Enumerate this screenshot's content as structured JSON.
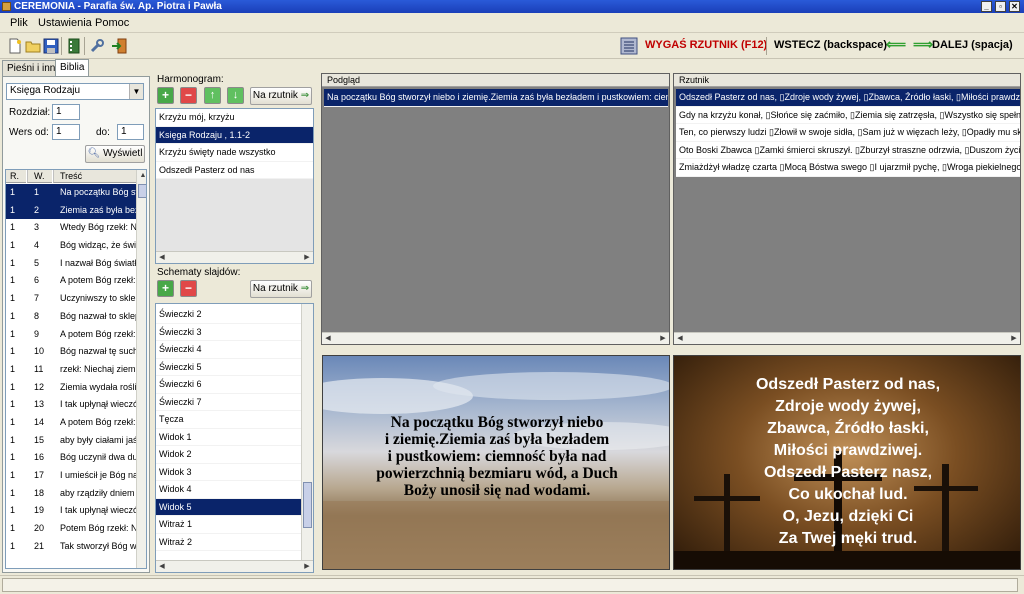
{
  "window": {
    "title": "CEREMONIA - Parafia św. Ap. Piotra i Pawła"
  },
  "menu": [
    "Plik",
    "Ustawienia",
    "Pomoc"
  ],
  "toolbar": {
    "blank_label": "WYGAŚ RZUTNIK (F12)",
    "back_label": "WSTECZ (backspace)",
    "next_label": "DALEJ (spacja)",
    "colors": {
      "blank": "#c00000"
    }
  },
  "tabs": [
    "Pieśni i inne",
    "Biblia"
  ],
  "bible": {
    "book": "Księga Rodzaju",
    "chapter_label": "Rozdział:",
    "chapter": "1",
    "verse_from_label": "Wers od:",
    "verse_from": "1",
    "verse_to_label": "do:",
    "verse_to": "1",
    "show_button": "Wyświetl",
    "columns": [
      "R.",
      "W.",
      "Treść"
    ],
    "rows": [
      [
        "1",
        "1",
        "Na początku Bóg stw"
      ],
      [
        "1",
        "2",
        "Ziemia zaś była bez"
      ],
      [
        "1",
        "3",
        "Wtedy Bóg rzekł: Ni"
      ],
      [
        "1",
        "4",
        "Bóg widząc, że świa"
      ],
      [
        "1",
        "5",
        "I nazwał Bóg światło"
      ],
      [
        "1",
        "6",
        "A potem Bóg rzekł:"
      ],
      [
        "1",
        "7",
        "Uczyniwszy to sklep"
      ],
      [
        "1",
        "8",
        "Bóg nazwał to sklep"
      ],
      [
        "1",
        "9",
        "A potem Bóg rzekł:"
      ],
      [
        "1",
        "10",
        "Bóg nazwał tę such"
      ],
      [
        "1",
        "11",
        "rzekł: Niechaj ziemia"
      ],
      [
        "1",
        "12",
        "Ziemia wydała roślin"
      ],
      [
        "1",
        "13",
        "I tak upłynął wieczó"
      ],
      [
        "1",
        "14",
        "A potem Bóg rzekł:"
      ],
      [
        "1",
        "15",
        "aby były ciałami jaśn"
      ],
      [
        "1",
        "16",
        "Bóg uczynił dwa du"
      ],
      [
        "1",
        "17",
        "I umieścił je Bóg na"
      ],
      [
        "1",
        "18",
        "aby rządziły dniem i"
      ],
      [
        "1",
        "19",
        "I tak upłynął wieczó"
      ],
      [
        "1",
        "20",
        "Potem Bóg rzekł: Ni"
      ],
      [
        "1",
        "21",
        "Tak stworzył Bóg wi"
      ]
    ],
    "selected": [
      0,
      1
    ]
  },
  "harmonogram": {
    "label": "Harmonogram:",
    "to_projector": "Na rzutnik",
    "items": [
      "Krzyżu mój, krzyżu",
      "Księga Rodzaju , 1.1-2",
      "Krzyżu święty nade wszystko",
      "Odszedł Pasterz od nas"
    ],
    "selected": 1
  },
  "schematy": {
    "label": "Schematy slajdów:",
    "to_projector": "Na rzutnik",
    "items": [
      "Świeczki 2",
      "Świeczki 3",
      "Świeczki 4",
      "Świeczki 5",
      "Świeczki 6",
      "Świeczki 7",
      "Tęcza",
      "Widok 1",
      "Widok 2",
      "Widok 3",
      "Widok 4",
      "Widok 5",
      "Witraż 1",
      "Witraż 2"
    ],
    "selected": 11
  },
  "podglad": {
    "label": "Podgląd",
    "items": [
      "Na początku Bóg stworzył niebo i ziemię.Ziemia zaś była bezładem i pustkowiem: ciemn..."
    ],
    "selected": 0,
    "slide_text": [
      "Na początku Bóg stworzył niebo",
      "i ziemię.Ziemia zaś była bezładem",
      "i pustkowiem: ciemność była nad",
      "powierzchnią bezmiaru wód, a Duch",
      "Boży unosił się nad wodami."
    ]
  },
  "rzutnik": {
    "label": "Rzutnik",
    "items": [
      "Odszedł Pasterz od nas, ▯Zdroje wody żywej, ▯Zbawca, Źródło łaski, ▯Miłości prawdzi...",
      "Gdy na krzyżu konał, ▯Słońce się zaćmiło, ▯Ziemia się zatrzęsła, ▯Wszystko się spełni...",
      "Ten, co pierwszy ludzi ▯Złowił w swoje sidła, ▯Sam już w więzach leży, ▯Opadły mu skr...",
      "Oto Boski Zbawca ▯Zamki śmierci skruszył. ▯Zburzył straszne odrzwia, ▯Duszom życie z...",
      "Zmiażdżył władzę czarta ▯Mocą Bóstwa swego ▯I ujarzmił pychę, ▯Wroga piekielnego. ..."
    ],
    "selected": 0,
    "slide_text": [
      "Odszedł Pasterz od nas,",
      "Zdroje wody żywej,",
      "Zbawca, Źródło łaski,",
      "Miłości prawdziwej.",
      "Odszedł Pasterz nasz,",
      "Co ukochał lud.",
      "O, Jezu, dzięki Ci",
      "Za Twej męki trud."
    ]
  }
}
